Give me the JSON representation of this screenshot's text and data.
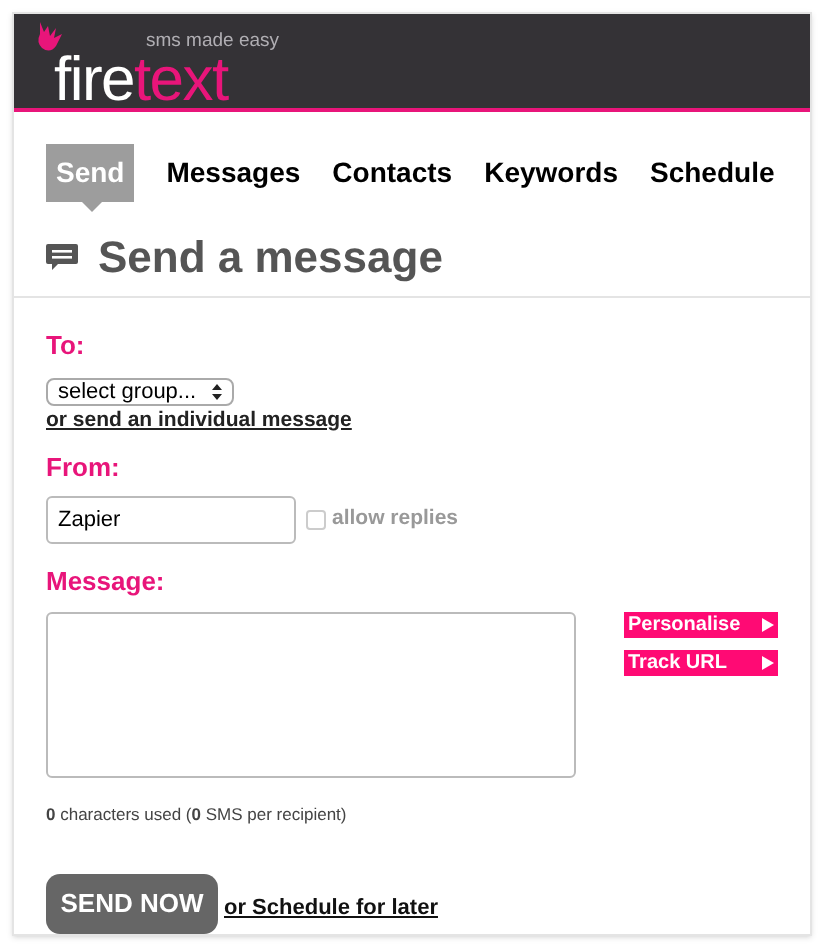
{
  "header": {
    "tagline": "sms made easy",
    "logo": [
      {
        "text": "fire",
        "color": "#ffffff"
      },
      {
        "text": "text",
        "color": "#e8157a"
      }
    ]
  },
  "tabs": [
    {
      "label": "Send",
      "selected": true
    },
    {
      "label": "Messages",
      "selected": false
    },
    {
      "label": "Contacts",
      "selected": false
    },
    {
      "label": "Keywords",
      "selected": false
    },
    {
      "label": "Schedule",
      "selected": false
    }
  ],
  "heading": "Send a message",
  "to": {
    "label": "To:",
    "select": "select group...",
    "link": "or send an individual message"
  },
  "from": {
    "label": "From:",
    "value": "Zapier",
    "allow_replies": {
      "label": "allow replies",
      "checked": false
    }
  },
  "message": {
    "label": "Message:",
    "actions": [
      "Personalise",
      "Track URL"
    ],
    "counter": "**0** characters used (**0** SMS per recipient)"
  },
  "send_button": "SEND NOW",
  "schedule_link": "or Schedule for later"
}
